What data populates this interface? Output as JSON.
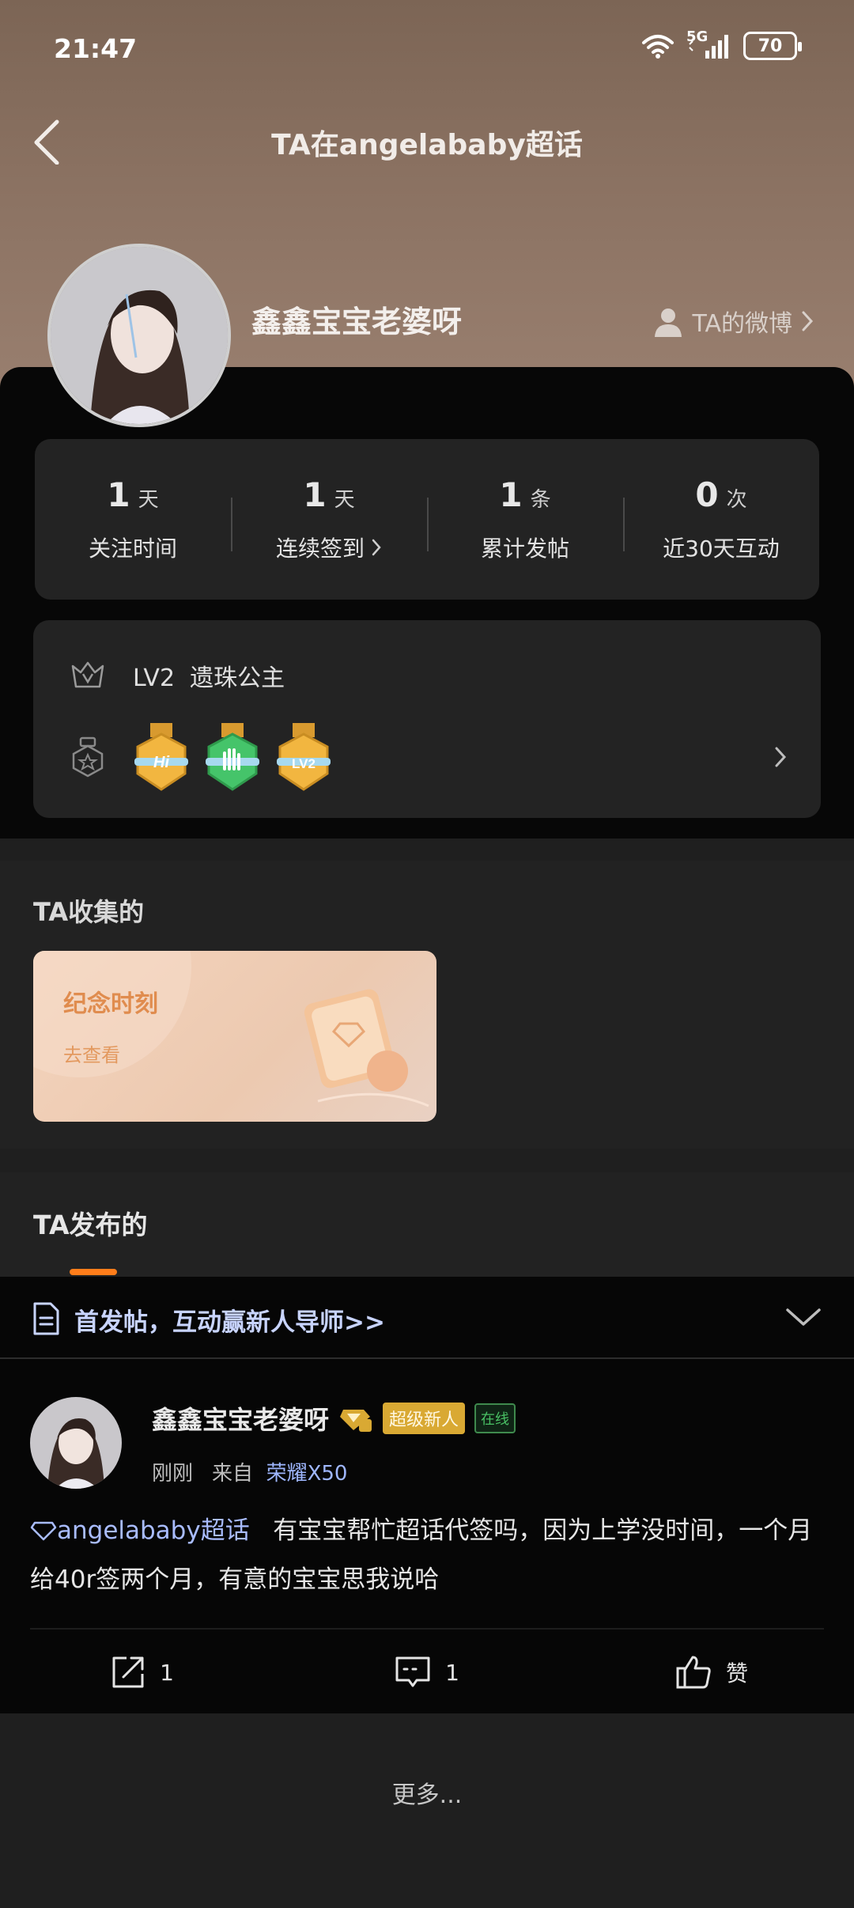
{
  "status_bar": {
    "time": "21:47",
    "network": "5G",
    "battery": "70"
  },
  "nav": {
    "title": "TA在angelababy超话"
  },
  "profile": {
    "name": "鑫鑫宝宝老婆呀",
    "weibo_link": "TA的微博"
  },
  "stats": [
    {
      "value": "1",
      "unit": "天",
      "label": "关注时间"
    },
    {
      "value": "1",
      "unit": "天",
      "label": "连续签到"
    },
    {
      "value": "1",
      "unit": "条",
      "label": "累计发帖"
    },
    {
      "value": "0",
      "unit": "次",
      "label": "近30天互动"
    }
  ],
  "level": {
    "level": "LV2",
    "title": "遗珠公主",
    "badges": [
      {
        "name": "hi-badge",
        "text": "Hi",
        "color": "#f2b640"
      },
      {
        "name": "hand-badge",
        "text": "",
        "color": "#45c46a"
      },
      {
        "name": "lv2-badge",
        "text": "LV2",
        "color": "#f2b640"
      }
    ]
  },
  "collect": {
    "title": "TA收集的",
    "card_title": "纪念时刻",
    "card_link": "去查看"
  },
  "posted": {
    "title": "TA发布的"
  },
  "pinned": {
    "text": "首发帖，互动赢新人导师>>"
  },
  "post": {
    "author": "鑫鑫宝宝老婆呀",
    "badge_super": "超级新人",
    "badge_online": "在线",
    "time": "刚刚",
    "from_label": "来自",
    "device": "荣耀X50",
    "topic": "angelababy超话",
    "content": "有宝宝帮忙超话代签吗，因为上学没时间，一个月给40r签两个月，有意的宝宝思我说哈",
    "share_count": "1",
    "comment_count": "1",
    "like_label": "赞"
  },
  "more": {
    "label": "更多..."
  },
  "colors": {
    "accent": "#ff7d1a",
    "link": "#a9bcff",
    "gold": "#d9a933"
  }
}
